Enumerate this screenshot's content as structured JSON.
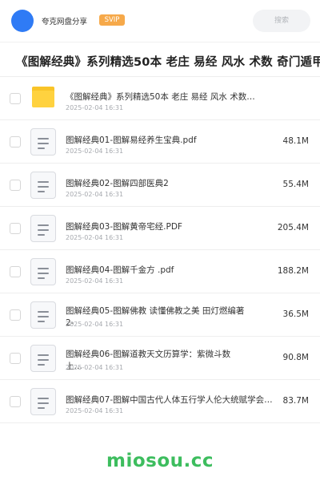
{
  "header": {
    "brand": "夸克网盘分享",
    "svip": "SVIP",
    "search_placeholder": "搜索"
  },
  "title": "《图解经典》系列精选50本 老庄 易经 风水 术数 奇门遁甲 —",
  "items": [
    {
      "type": "folder",
      "name": "《图解经典》系列精选50本 老庄 易经 风水 术数…",
      "date": "2025-02-04 16:31",
      "size": ""
    },
    {
      "type": "file",
      "name": "图解经典01-图解易经养生宝典.pdf",
      "date": "2025-02-04 16:31",
      "size": "48.1M"
    },
    {
      "type": "file",
      "name": "图解经典02-图解四部医典2",
      "date": "2025-02-04 16:31",
      "size": "55.4M"
    },
    {
      "type": "file",
      "name": "图解经典03-图解黄帝宅经.PDF",
      "date": "2025-02-04 16:31",
      "size": "205.4M"
    },
    {
      "type": "file",
      "name": "图解经典04-图解千金方 .pdf",
      "date": "2025-02-04 16:31",
      "size": "188.2M"
    },
    {
      "type": "file",
      "name": "图解经典05-图解佛教 读懂佛教之美 田灯燃编著2-",
      "date": "2025-02-04 16:31",
      "size": "36.5M"
    },
    {
      "type": "file",
      "name": "图解经典06-图解道教天文历算学：紫微斗数 上…",
      "date": "2025-02-04 16:31",
      "size": "90.8M"
    },
    {
      "type": "file",
      "name": "图解经典07-图解中国古代人体五行学人伦大统赋学会…",
      "date": "2025-02-04 16:31",
      "size": "83.7M"
    }
  ],
  "watermark": "miosou.cc",
  "colors": {
    "avatar": "#2f7bf5",
    "svip_badge": "#f6a94a",
    "folder": "#ffd23f",
    "watermark": "#3dbd5e"
  }
}
